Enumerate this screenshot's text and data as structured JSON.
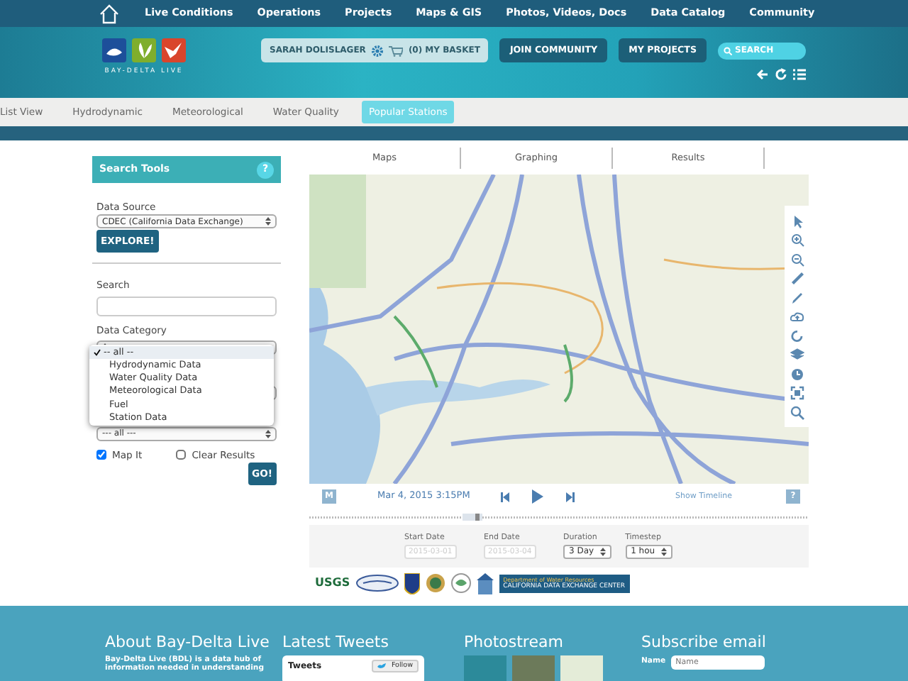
{
  "top_nav": {
    "items": [
      "Live Conditions",
      "Operations",
      "Projects",
      "Maps & GIS",
      "Photos, Videos, Docs",
      "Data Catalog",
      "Community"
    ]
  },
  "header": {
    "logo_text": "BAY-DELTA LIVE",
    "user": "SARAH DOLISLAGER",
    "basket": "(0) MY BASKET",
    "buttons": [
      "JOIN COMMUNITY",
      "MY PROJECTS"
    ],
    "search": {
      "placeholder": "SEARCH"
    }
  },
  "sub_tabs": [
    {
      "label": "List View",
      "selected": false
    },
    {
      "label": "Hydrodynamic",
      "selected": false
    },
    {
      "label": "Meteorological",
      "selected": false
    },
    {
      "label": "Water Quality",
      "selected": false
    },
    {
      "label": "Popular Stations",
      "selected": true
    }
  ],
  "search_tools": {
    "title": "Search Tools",
    "help": "?",
    "data_source_label": "Data Source",
    "data_source": "CDEC (California Data Exchange)",
    "explore": "EXPLORE!",
    "search_label": "Search",
    "data_category_label": "Data Category",
    "data_category_options": [
      {
        "label": "-- all --",
        "selected": true
      },
      {
        "label": "Hydrodynamic Data",
        "selected": false
      },
      {
        "label": "Water Quality Data",
        "selected": false
      },
      {
        "label": "Meteorological Data",
        "selected": false
      },
      {
        "label": "Fuel",
        "selected": false
      },
      {
        "label": "Station Data",
        "selected": false
      }
    ],
    "filter_3": "--- all ---",
    "checkboxes": [
      {
        "label": "Map It",
        "checked": true
      },
      {
        "label": "Clear Results",
        "checked": false
      }
    ],
    "go": "GO!"
  },
  "view_tabs": [
    "Maps",
    "Graphing",
    "Results"
  ],
  "player": {
    "mode_button": "M",
    "time": "Mar 4, 2015 3:15PM",
    "show_timeline": "Show Timeline",
    "help": "?"
  },
  "date_controls": [
    {
      "label": "Start Date",
      "placeholder": "2015-03-01",
      "kind": "date"
    },
    {
      "label": "End Date",
      "placeholder": "2015-03-04",
      "kind": "date"
    },
    {
      "label": "Duration",
      "value": "3 Day",
      "kind": "select"
    },
    {
      "label": "Timestep",
      "value": "1 hou",
      "kind": "select"
    }
  ],
  "partner_logos": {
    "usgs": "USGS",
    "cdec_line_1": "Department of Water Resources",
    "cdec_line_2": "CALIFORNIA DATA EXCHANGE CENTER"
  },
  "footer": {
    "about_title": "About Bay-Delta Live",
    "about_text": "Bay-Delta Live (BDL) is a data hub of information needed in understanding",
    "tweets_title": "Latest Tweets",
    "tweets_label": "Tweets",
    "follow": "Follow",
    "photostream_title": "Photostream",
    "subscribe_title": "Subscribe email",
    "name_label": "Name",
    "name_placeholder": "Name"
  }
}
